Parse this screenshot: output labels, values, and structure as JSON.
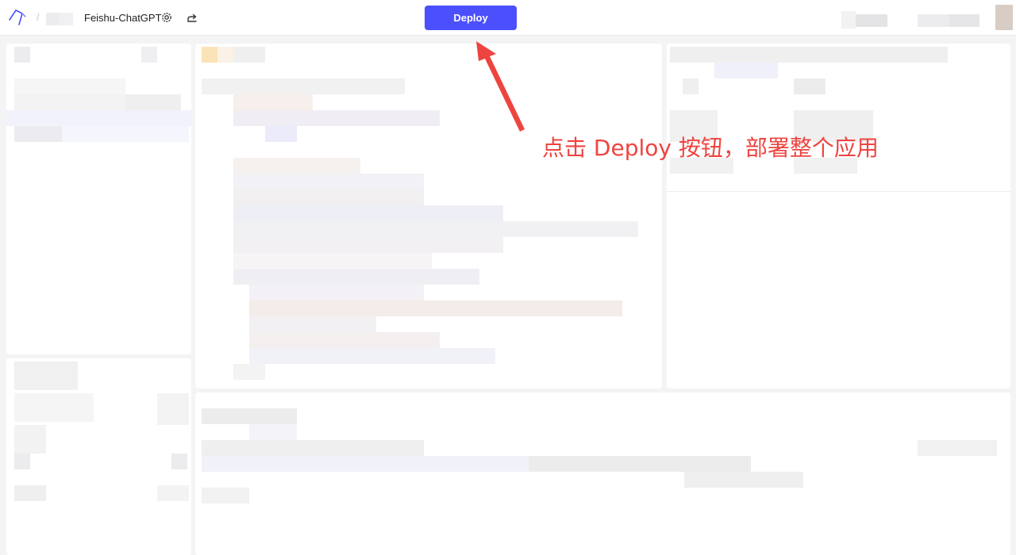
{
  "header": {
    "breadcrumb_separator": "/",
    "app_name": "Feishu-ChatGPT",
    "deploy_label": "Deploy",
    "icons": [
      "app-logo-icon",
      "gear-icon",
      "share-icon"
    ]
  },
  "annotation": {
    "text": "点击 Deploy 按钮，部署整个应用"
  },
  "colors": {
    "accent": "#4b4ffc",
    "annotation": "#ee4440",
    "canvas_bg": "#f4f4f5",
    "panel_bg": "#ffffff"
  }
}
